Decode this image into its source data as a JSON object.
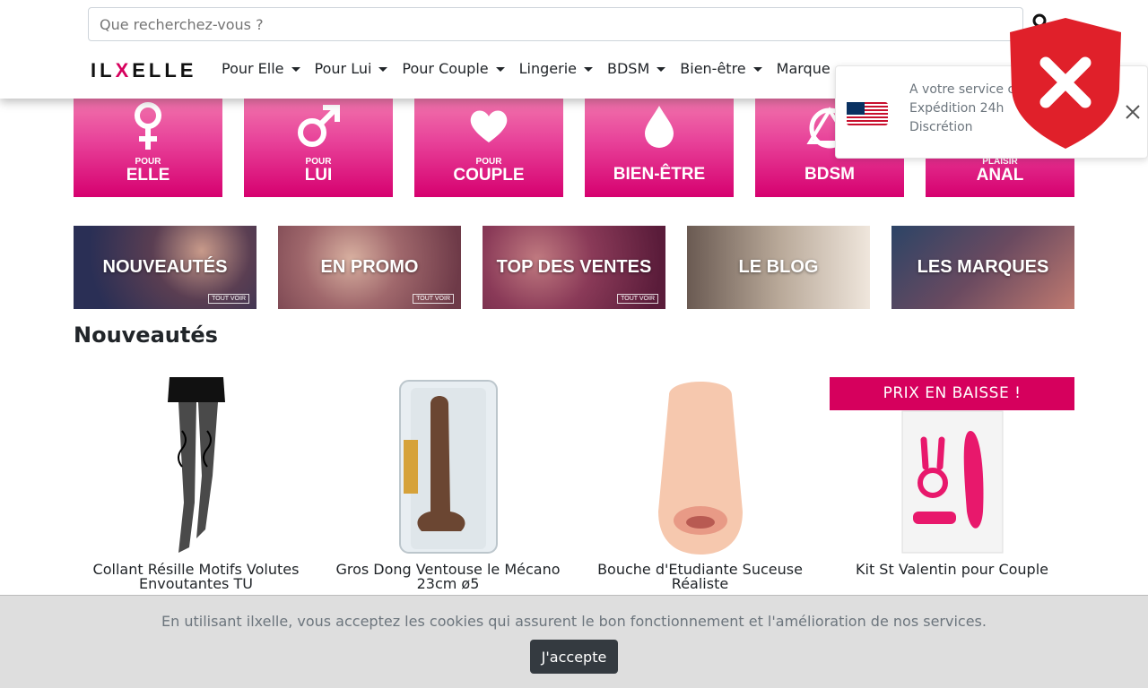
{
  "search": {
    "placeholder": "Que recherchez-vous ?"
  },
  "logo": {
    "part1": "IL",
    "part2": "X",
    "part3": "ELLE"
  },
  "nav": [
    {
      "label": "Pour Elle",
      "dropdown": true
    },
    {
      "label": "Pour Lui",
      "dropdown": true
    },
    {
      "label": "Pour Couple",
      "dropdown": true
    },
    {
      "label": "Lingerie",
      "dropdown": true
    },
    {
      "label": "BDSM",
      "dropdown": true
    },
    {
      "label": "Bien-être",
      "dropdown": true
    },
    {
      "label": "Marque",
      "dropdown": false
    }
  ],
  "categories": [
    {
      "pour": "POUR",
      "name": "ELLE",
      "icon": "female-symbol-icon"
    },
    {
      "pour": "POUR",
      "name": "LUI",
      "icon": "male-symbol-icon"
    },
    {
      "pour": "POUR",
      "name": "COUPLE",
      "icon": "heart-icon"
    },
    {
      "pour": "",
      "name": "BIEN-ÊTRE",
      "icon": "droplet-icon"
    },
    {
      "pour": "",
      "name": "BDSM",
      "icon": "bdsm-symbol-icon"
    },
    {
      "pour": "PLAISIR",
      "name": "ANAL",
      "icon": ""
    }
  ],
  "banners": [
    {
      "label": "NOUVEAUTÉS",
      "tag": "TOUT VOIR",
      "color": "#2a2f55"
    },
    {
      "label": "EN PROMO",
      "tag": "TOUT VOIR",
      "color": "#7a4a52"
    },
    {
      "label": "TOP DES VENTES",
      "tag": "TOUT VOIR",
      "color": "#6e2a48"
    },
    {
      "label": "LE BLOG",
      "tag": "",
      "color": "#8a7a70"
    },
    {
      "label": "LES MARQUES",
      "tag": "",
      "color": "#3b4e6a"
    }
  ],
  "section_title": "Nouveautés",
  "products": [
    {
      "name": "Collant Résille Motifs Volutes Envoutantes TU",
      "badge": ""
    },
    {
      "name": "Gros Dong Ventouse le Mécano 23cm ø5",
      "badge": ""
    },
    {
      "name": "Bouche d'Etudiante Suceuse Réaliste",
      "badge": ""
    },
    {
      "name": "Kit St Valentin pour Couple",
      "badge": "PRIX EN BAISSE !"
    }
  ],
  "notification": {
    "line1": "A votre service c",
    "line2": "Expédition 24h",
    "line3": "Discrétion",
    "flag": "us-flag-icon"
  },
  "cookie": {
    "text": "En utilisant ilxelle, vous acceptez les cookies qui assurent le bon fonctionnement et l'amélioration de nos services.",
    "button": "J'accepte"
  },
  "colors": {
    "brand": "#d6005d",
    "tile_pink": "#e8439a",
    "shield_red": "#e0202a"
  }
}
